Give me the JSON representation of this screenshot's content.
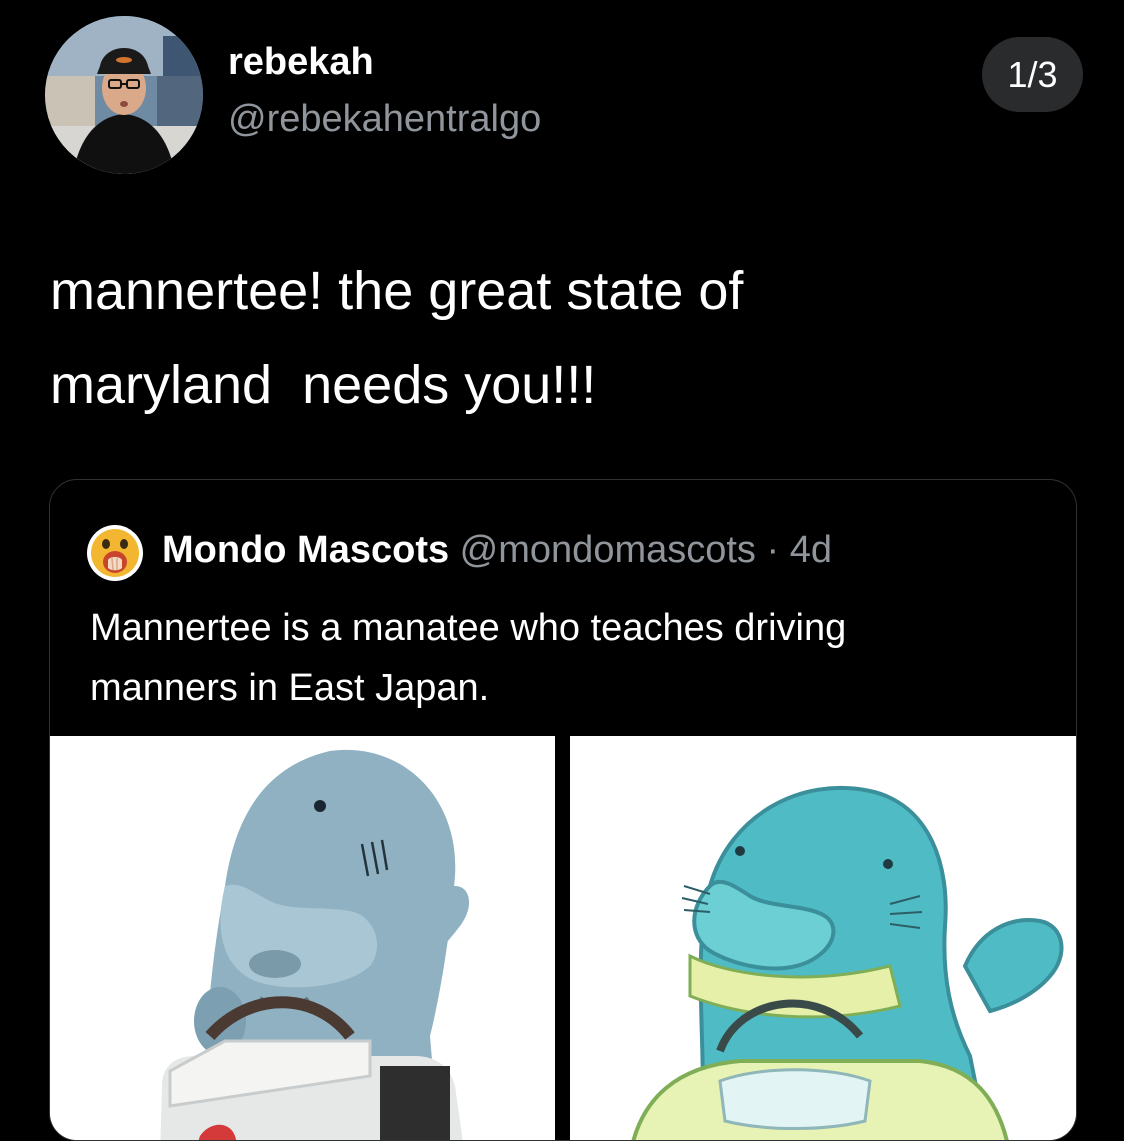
{
  "author": {
    "display_name": "rebekah",
    "handle": "@rebekahentralgo"
  },
  "pagination": {
    "label": "1/3"
  },
  "tweet": {
    "text": "mannertee! the great state of\nmaryland  needs you!!!"
  },
  "quoted_tweet": {
    "name": "Mondo Mascots",
    "meta": " @mondomascots · 4d",
    "text": "Mannertee is a manatee who teaches driving\nmanners in East Japan."
  },
  "colors": {
    "background": "#000000",
    "secondary_text": "#8f959b",
    "badge_bg": "#2a2b2d",
    "card_border": "#2f3336"
  },
  "icons": {
    "quote_avatar": "shocked-emoji-face"
  }
}
